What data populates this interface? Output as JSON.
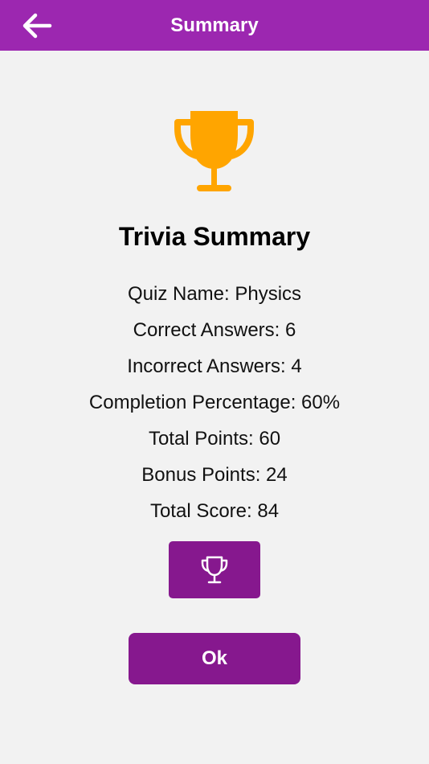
{
  "header": {
    "title": "Summary",
    "back_icon": "arrow-left-icon"
  },
  "hero": {
    "icon": "trophy-icon",
    "icon_color": "#ffa500"
  },
  "summary": {
    "heading": "Trivia Summary",
    "quiz_name": "Quiz Name: Physics",
    "correct_answers": "Correct Answers: 6",
    "incorrect_answers": "Incorrect Answers: 4",
    "completion_percentage": "Completion Percentage: 60%",
    "total_points": "Total Points: 60",
    "bonus_points": "Bonus Points: 24",
    "total_score": "Total Score: 84"
  },
  "actions": {
    "leaderboard_icon": "trophy-outline-icon",
    "ok_label": "Ok"
  },
  "colors": {
    "header_bg": "#9c27b0",
    "button_bg": "#86188e",
    "background": "#f2f2f2",
    "trophy": "#ffa500"
  }
}
